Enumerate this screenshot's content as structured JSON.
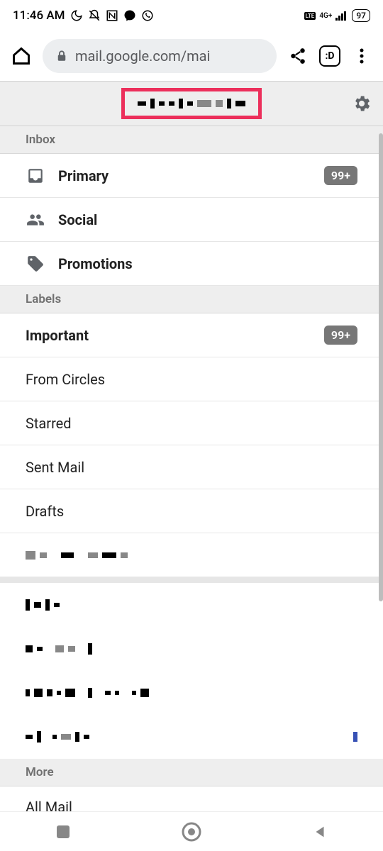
{
  "status": {
    "time": "11:46 AM",
    "network_label": "4G+",
    "battery": "97"
  },
  "browser": {
    "url": "mail.google.com/mai",
    "tab_count": ":D"
  },
  "account": {
    "email_redacted": true
  },
  "sections": {
    "inbox_header": "Inbox",
    "labels_header": "Labels",
    "more_header": "More"
  },
  "inbox_tabs": [
    {
      "label": "Primary",
      "badge": "99+",
      "icon": "inbox"
    },
    {
      "label": "Social",
      "badge": null,
      "icon": "people"
    },
    {
      "label": "Promotions",
      "badge": null,
      "icon": "tag"
    }
  ],
  "labels": [
    {
      "label": "Important",
      "badge": "99+",
      "bold": true
    },
    {
      "label": "From Circles",
      "badge": null,
      "bold": false
    },
    {
      "label": "Starred",
      "badge": null,
      "bold": false
    },
    {
      "label": "Sent Mail",
      "badge": null,
      "bold": false
    },
    {
      "label": "Drafts",
      "badge": null,
      "bold": false
    }
  ],
  "custom_labels_redacted_count": 5,
  "more": {
    "all_mail": "All Mail"
  }
}
